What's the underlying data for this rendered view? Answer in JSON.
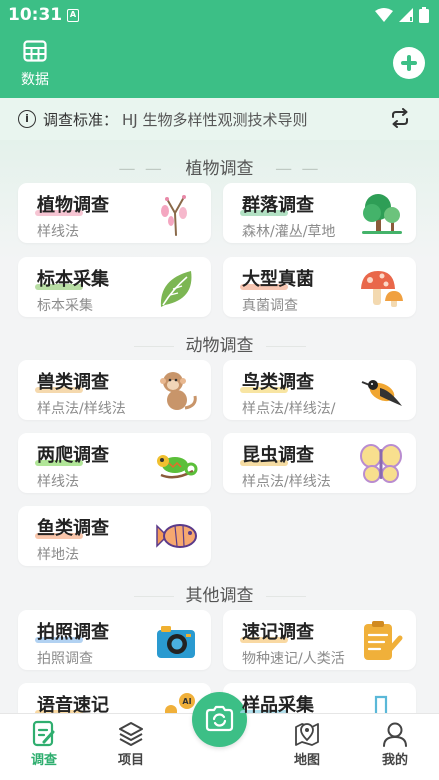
{
  "status_bar": {
    "time": "10:31",
    "badge": "A"
  },
  "header": {
    "data_label": "数据"
  },
  "standard": {
    "label": "调查标准：",
    "value": "HJ 生物多样性观测技术导则"
  },
  "sections": {
    "plants": {
      "title": "植物调查",
      "dash_left": "— —",
      "dash_right": "— —"
    },
    "animals": {
      "title": "动物调查"
    },
    "others": {
      "title": "其他调查"
    }
  },
  "cards": [
    {
      "title": "植物调查",
      "sub": "样线法",
      "icon": "flower-branch-icon",
      "underline": "#f4b6c8"
    },
    {
      "title": "群落调查",
      "sub": "森林/灌丛/草地",
      "icon": "trees-icon",
      "underline": "#9fd8b4"
    },
    {
      "title": "标本采集",
      "sub": "标本采集",
      "icon": "leaf-icon",
      "underline": "#a8d68e"
    },
    {
      "title": "大型真菌",
      "sub": "真菌调查",
      "icon": "mushroom-icon",
      "underline": "#f5b89f"
    },
    {
      "title": "兽类调查",
      "sub": "样点法/样线法",
      "icon": "monkey-icon",
      "underline": "#f3cf9a"
    },
    {
      "title": "鸟类调查",
      "sub": "样点法/样线法/",
      "icon": "bird-icon",
      "underline": "#f6de8c"
    },
    {
      "title": "两爬调查",
      "sub": "样线法",
      "icon": "chameleon-icon",
      "underline": "#9de07e"
    },
    {
      "title": "昆虫调查",
      "sub": "样点法/样线法",
      "icon": "butterfly-icon",
      "underline": "#f3d38c"
    },
    {
      "title": "鱼类调查",
      "sub": "样地法",
      "icon": "fish-icon",
      "underline": "#f7b896"
    },
    {
      "title": "拍照调查",
      "sub": "拍照调查",
      "icon": "camera-icon",
      "underline": "#9fc7ef"
    },
    {
      "title": "速记调查",
      "sub": "物种速记/人类活",
      "icon": "notepad-icon",
      "underline": "#f7cf8c"
    },
    {
      "title": "语音速记",
      "sub": "",
      "icon": "microphone-ai-icon",
      "underline": "#f7cf8c"
    },
    {
      "title": "样品采集",
      "sub": "",
      "icon": "test-tube-icon",
      "underline": "#9fd8e8"
    }
  ],
  "tabs": [
    {
      "label": "调查",
      "icon": "survey-icon",
      "active": true
    },
    {
      "label": "项目",
      "icon": "layers-icon",
      "active": false
    },
    {
      "label": "地图",
      "icon": "map-pin-icon",
      "active": false
    },
    {
      "label": "我的",
      "icon": "profile-icon",
      "active": false
    }
  ],
  "colors": {
    "brand": "#3cbf86",
    "active_tab": "#2fae6f",
    "background": "#f3f4f5"
  }
}
